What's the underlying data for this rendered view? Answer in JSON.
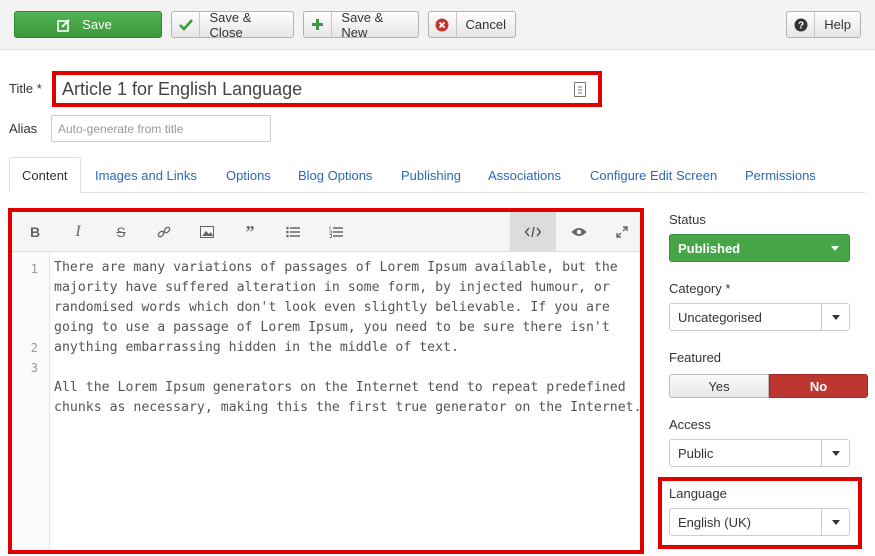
{
  "toolbar": {
    "save_label": "Save",
    "save_close_label": "Save & Close",
    "save_new_label": "Save & New",
    "cancel_label": "Cancel",
    "help_label": "Help"
  },
  "form": {
    "title_label": "Title *",
    "title_value": "Article 1 for English Language",
    "alias_label": "Alias",
    "alias_placeholder": "Auto-generate from title"
  },
  "tabs": [
    {
      "label": "Content",
      "active": true
    },
    {
      "label": "Images and Links"
    },
    {
      "label": "Options"
    },
    {
      "label": "Blog Options"
    },
    {
      "label": "Publishing"
    },
    {
      "label": "Associations"
    },
    {
      "label": "Configure Edit Screen"
    },
    {
      "label": "Permissions"
    }
  ],
  "editor": {
    "tools": [
      "bold-icon",
      "italic-icon",
      "strikethrough-icon",
      "link-icon",
      "image-icon",
      "quote-icon",
      "bullet-list-icon",
      "numbered-list-icon",
      "code-view-icon",
      "preview-icon",
      "fullscreen-icon"
    ],
    "line_numbers": [
      "1",
      "2",
      "3"
    ],
    "lines": [
      "There are many variations of passages of Lorem Ipsum available, but the majority have suffered alteration in some form, by injected humour, or randomised words which don't look even slightly believable. If you are going to use a passage of Lorem Ipsum, you need to be sure there isn't anything embarrassing hidden in the middle of text.",
      "",
      "All the Lorem Ipsum generators on the Internet tend to repeat predefined chunks as necessary, making this the first true generator on the Internet."
    ]
  },
  "sidebar": {
    "status_label": "Status",
    "status_value": "Published",
    "category_label": "Category *",
    "category_value": "Uncategorised",
    "featured_label": "Featured",
    "featured_yes": "Yes",
    "featured_no": "No",
    "featured_value": "No",
    "access_label": "Access",
    "access_value": "Public",
    "language_label": "Language",
    "language_value": "English (UK)"
  },
  "colors": {
    "save_green": "#46a546",
    "highlight_red": "#e00000",
    "no_red": "#bd362f",
    "link_blue": "#2a69b8"
  }
}
